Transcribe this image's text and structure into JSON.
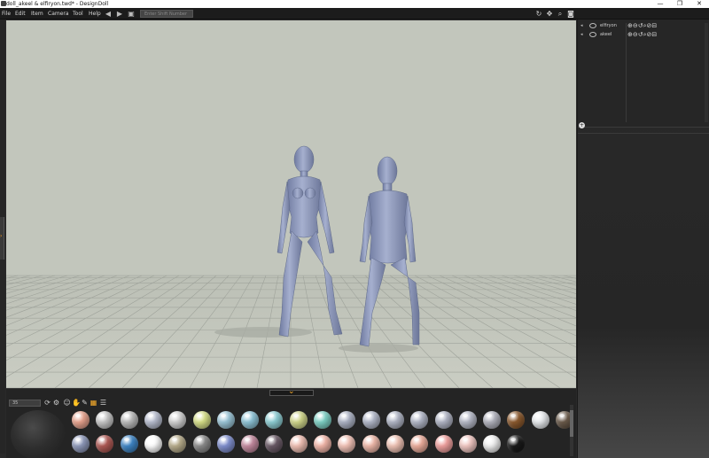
{
  "window": {
    "title": "doll_akeel & elfiryon.twd* - DesignDoll",
    "controls": [
      "—",
      "❐",
      "✕"
    ]
  },
  "menu": {
    "items": [
      "File",
      "Edit",
      "Item",
      "Camera",
      "Tool",
      "Help"
    ]
  },
  "toolbar": {
    "undo_icon": "undo-arrow-icon",
    "redo_icon": "redo-arrow-icon",
    "animation_icon": "film-camera-icon",
    "frame_input_placeholder": "Enter Shift Number",
    "camera_icons": [
      "rotate-icon",
      "pan-icon",
      "zoom-icon",
      "screenshot-icon"
    ]
  },
  "scene": {
    "background_color": "#c2c6bc",
    "floor_color": "#c4c7bd",
    "grid_color": "#9ea29a",
    "figures": [
      {
        "id": "female-doll",
        "color": "#8f9abb"
      },
      {
        "id": "male-doll",
        "color": "#8f9abb"
      }
    ]
  },
  "bottom_panel": {
    "size_value": "35",
    "accent_color": "#ffb12b",
    "materials_row1": [
      "#e9a48f",
      "#c9c9c9",
      "#bdbdbd",
      "#b9bfd1",
      "#d3d3d3",
      "#d9e28a",
      "#9cc7d9",
      "#8fc5d8",
      "#8fd0d6",
      "#d2d88c",
      "#7fd3c7",
      "#aeb4c6",
      "#b3b9ca",
      "#b2b7c7",
      "#b3b8c8",
      "#b2b6c6",
      "#b7bac8",
      "#b3b4bf",
      "#8c5a2e",
      "#e9ecef",
      "#6a5a4a"
    ],
    "materials_row2": [
      "#8f9abb",
      "#b05a55",
      "#3f86c6",
      "#ffffff",
      "#b8ad8c",
      "#8c8c8c",
      "#8190d0",
      "#c58ba0",
      "#6a5a66",
      "#f1c0b4",
      "#f3b7aa",
      "#f4c4b8",
      "#f0b9aa",
      "#f1c4b6",
      "#eeae9d",
      "#f2a2a0",
      "#f3c9c4",
      "#f2f2f2",
      "#1a1a1a"
    ]
  },
  "right_panel": {
    "objects": [
      {
        "name": "elfiryon",
        "expand_icon": "expand-arrow-icon"
      },
      {
        "name": "akeel",
        "expand_icon": "expand-arrow-icon"
      }
    ],
    "object_tools": "⊕⊖↺⌕⊘⊟",
    "add_label": "+"
  }
}
